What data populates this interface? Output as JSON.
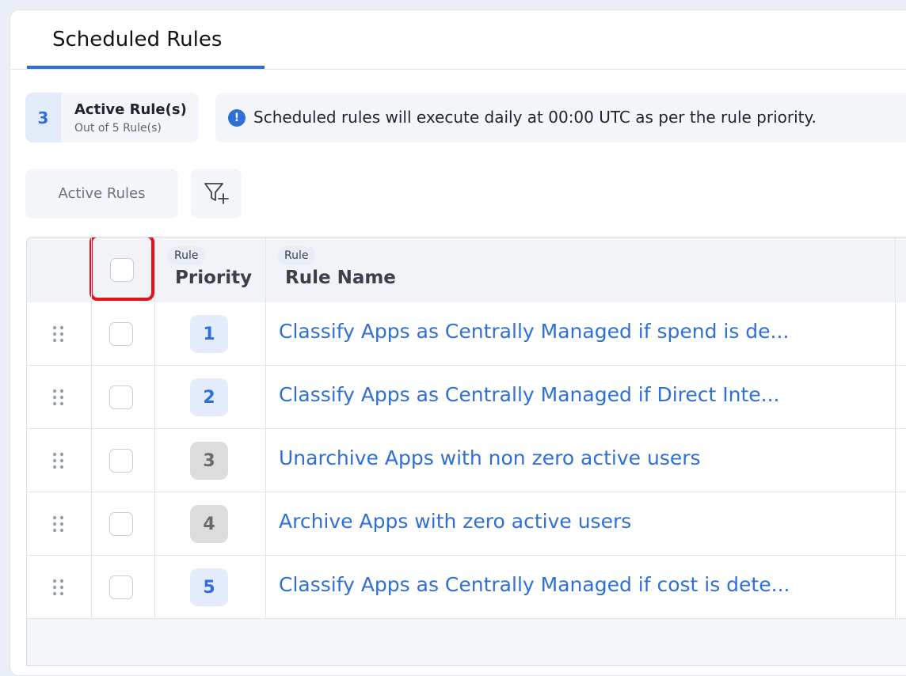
{
  "tabs": [
    {
      "label": "Scheduled Rules",
      "active": true
    }
  ],
  "summary": {
    "active_count": "3",
    "title": "Active Rule(s)",
    "subtitle": "Out of 5 Rule(s)"
  },
  "banner": {
    "icon": "info-icon",
    "glyph": "!",
    "text": "Scheduled rules will execute daily at 00:00 UTC as per the rule priority."
  },
  "filters": {
    "chip_label": "Active Rules",
    "add_filter_icon": "filter-plus-icon"
  },
  "table": {
    "columns": {
      "priority": {
        "pill": "Rule",
        "title": "Priority"
      },
      "name": {
        "pill": "Rule",
        "title": "Rule Name"
      }
    },
    "rows": [
      {
        "priority": "1",
        "status": "active",
        "name": "Classify Apps as Centrally Managed if spend is de..."
      },
      {
        "priority": "2",
        "status": "active",
        "name": "Classify Apps as Centrally Managed if Direct Inte..."
      },
      {
        "priority": "3",
        "status": "inactive",
        "name": "Unarchive Apps with non zero active users"
      },
      {
        "priority": "4",
        "status": "inactive",
        "name": "Archive Apps with zero active users"
      },
      {
        "priority": "5",
        "status": "active",
        "name": "Classify Apps as Centrally Managed if cost is dete..."
      }
    ]
  },
  "colors": {
    "accent": "#2f6fd8",
    "highlight": "#e0141e",
    "inactive_badge": "#dcdcdc"
  }
}
